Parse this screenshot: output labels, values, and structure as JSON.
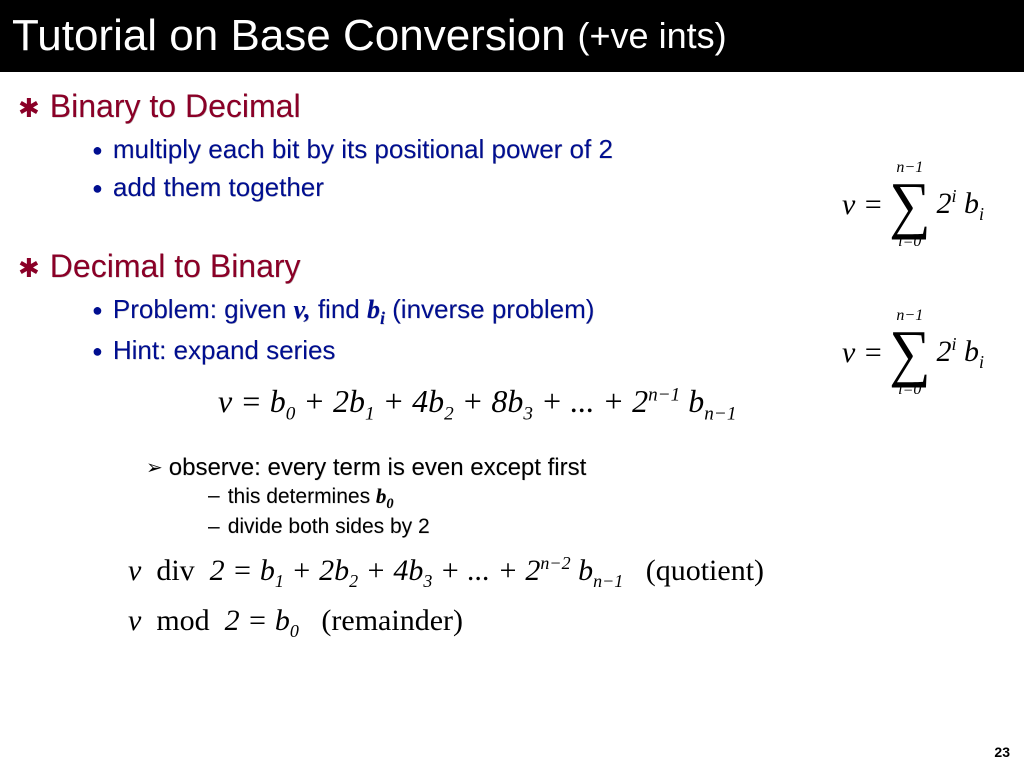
{
  "title": {
    "main": "Tutorial on Base Conversion",
    "sub": "(+ve ints)"
  },
  "sections": [
    {
      "heading": "Binary to Decimal",
      "points": [
        "multiply each bit by its positional power of 2",
        "add them together"
      ]
    },
    {
      "heading": "Decimal to Binary",
      "points_html": [
        "Problem:  given <span class='ital-serif'>v,</span> find <span class='ital-serif'>b<span class='sub'>i</span></span> (inverse problem)",
        "Hint:  expand series"
      ]
    }
  ],
  "observe": {
    "line": "observe: every term is even except first",
    "subs": [
      "this determines <span class='ital-serif'>b<span class='sub'>0</span></span>",
      "divide both sides by 2"
    ]
  },
  "formulas": {
    "sigma": {
      "lhs": "v =",
      "upper": "n−1",
      "lower": "i=0",
      "rhs": "2<span class='sup'>i</span> b<span class='ssub'>i</span>"
    },
    "expand": "v = b<span class='ssub'>0</span> + 2b<span class='ssub'>1</span> + 4b<span class='ssub'>2</span> + 8b<span class='ssub'>3</span> + ... + 2<span class='sup'>n−1</span> b<span class='ssub'>n−1</span>",
    "div": "v&nbsp; <span class='rm'>div</span>&nbsp; 2 = b<span class='ssub'>1</span> + 2b<span class='ssub'>2</span> + 4b<span class='ssub'>3</span> + ... + 2<span class='sup'>n−2</span> b<span class='ssub'>n−1</span> &nbsp;&nbsp;<span class='rm'>(quotient)</span>",
    "mod": "v&nbsp; <span class='rm'>mod</span>&nbsp; 2 = b<span class='ssub'>0</span> &nbsp;&nbsp;<span class='rm'>(remainder)</span>"
  },
  "page_number": "23"
}
